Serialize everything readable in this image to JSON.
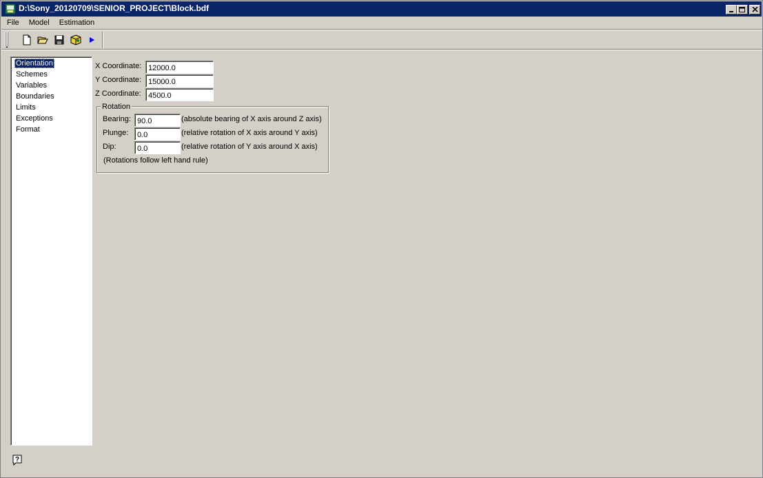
{
  "window": {
    "title": "D:\\Sony_20120709\\SENIOR_PROJECT\\Block.bdf"
  },
  "menu": [
    "File",
    "Model",
    "Estimation"
  ],
  "toolbar": {
    "buttons": [
      "new-file",
      "open-folder",
      "save",
      "package-cube",
      "run-play"
    ]
  },
  "tree": {
    "items": [
      "Orientation",
      "Schemes",
      "Variables",
      "Boundaries",
      "Limits",
      "Exceptions",
      "Format"
    ],
    "selected": "Orientation"
  },
  "orientation": {
    "x_label": "X Coordinate:",
    "x_value": "12000.0",
    "y_label": "Y Coordinate:",
    "y_value": "15000.0",
    "z_label": "Z Coordinate:",
    "z_value": "4500.0",
    "rotation": {
      "title": "Rotation",
      "bearing_label": "Bearing:",
      "bearing_value": "90.0",
      "bearing_note": "(absolute bearing of X axis around Z axis)",
      "plunge_label": "Plunge:",
      "plunge_value": "0.0",
      "plunge_note": "(relative rotation of X axis around Y axis)",
      "dip_label": "Dip:",
      "dip_value": "0.0",
      "dip_note": "(relative rotation of Y axis around X axis)",
      "footnote": "(Rotations follow left hand rule)"
    }
  },
  "colors": {
    "titlebar": "#0a246a",
    "face": "#d4d0c8",
    "selection": "#0a246a"
  }
}
